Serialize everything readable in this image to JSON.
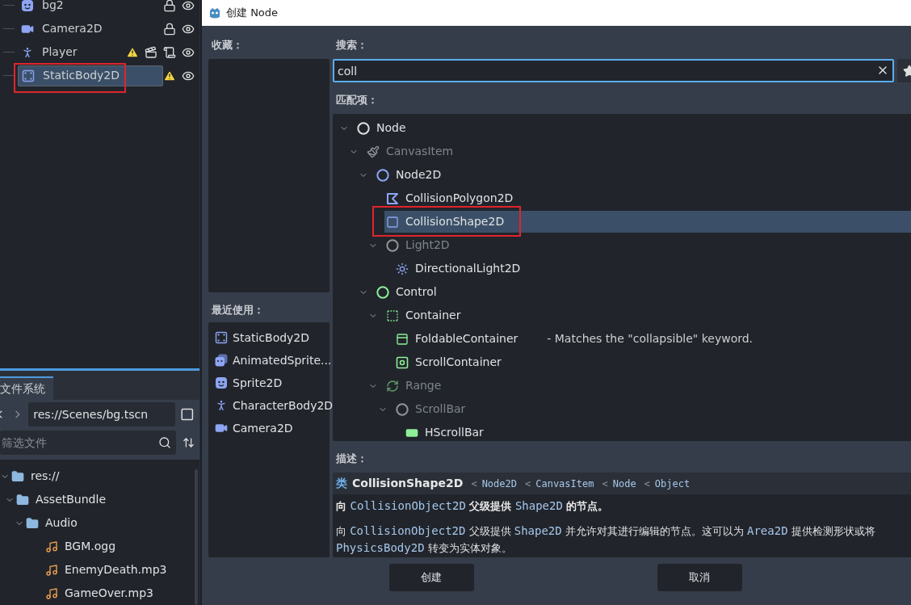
{
  "scene_tree": [
    {
      "name": "bg2",
      "kind": "sprite",
      "selected": false,
      "warning": false,
      "has_scene": false,
      "has_script": false,
      "locked": true,
      "visible": true
    },
    {
      "name": "Camera2D",
      "kind": "camera",
      "selected": false,
      "warning": false,
      "has_scene": false,
      "has_script": false,
      "locked": true,
      "visible": true
    },
    {
      "name": "Player",
      "kind": "character",
      "selected": false,
      "warning": true,
      "has_scene": true,
      "has_script": true,
      "locked": false,
      "visible": true
    },
    {
      "name": "StaticBody2D",
      "kind": "static",
      "selected": true,
      "warning": true,
      "has_scene": false,
      "has_script": false,
      "locked": false,
      "visible": true
    }
  ],
  "filesystem": {
    "tab": "文件系统",
    "path": "res://Scenes/bg.tscn",
    "filter_placeholder": "筛选文件",
    "tree": [
      {
        "name": "res://",
        "kind": "folder",
        "expanded": true,
        "children": [
          {
            "name": "AssetBundle",
            "kind": "folder",
            "expanded": true,
            "children": [
              {
                "name": "Audio",
                "kind": "folder",
                "expanded": true,
                "children": [
                  {
                    "name": "BGM.ogg",
                    "kind": "audio"
                  },
                  {
                    "name": "EnemyDeath.mp3",
                    "kind": "audio"
                  },
                  {
                    "name": "GameOver.mp3",
                    "kind": "audio"
                  }
                ]
              }
            ]
          }
        ]
      }
    ]
  },
  "dialog": {
    "title": "创建 Node",
    "favorites_label": "收藏：",
    "recent_label": "最近使用：",
    "recent": [
      {
        "name": "StaticBody2D",
        "kind": "static"
      },
      {
        "name": "AnimatedSprite...",
        "kind": "animated"
      },
      {
        "name": "Sprite2D",
        "kind": "sprite"
      },
      {
        "name": "CharacterBody2D",
        "kind": "character"
      },
      {
        "name": "Camera2D",
        "kind": "camera"
      }
    ],
    "search_label": "搜索：",
    "search_value": "coll",
    "matches_label": "匹配项：",
    "matches": [
      {
        "name": "Node",
        "kind": "circle-white",
        "dimmed": false,
        "selected": false,
        "children": [
          {
            "name": "CanvasItem",
            "kind": "brush",
            "dimmed": true,
            "selected": false,
            "children": [
              {
                "name": "Node2D",
                "kind": "circle-blue",
                "dimmed": false,
                "selected": false,
                "children": [
                  {
                    "name": "CollisionPolygon2D",
                    "kind": "polygon",
                    "dimmed": false,
                    "selected": false
                  },
                  {
                    "name": "CollisionShape2D",
                    "kind": "square",
                    "dimmed": false,
                    "selected": true
                  },
                  {
                    "name": "Light2D",
                    "kind": "circle-white",
                    "dimmed": true,
                    "selected": false,
                    "children": [
                      {
                        "name": "DirectionalLight2D",
                        "kind": "sun",
                        "dimmed": false,
                        "selected": false
                      }
                    ]
                  }
                ]
              },
              {
                "name": "Control",
                "kind": "circle-green",
                "dimmed": false,
                "selected": false,
                "children": [
                  {
                    "name": "Container",
                    "kind": "dotted",
                    "dimmed": false,
                    "selected": false,
                    "children": [
                      {
                        "name": "FoldableContainer",
                        "kind": "foldable",
                        "dimmed": false,
                        "selected": false,
                        "note": "- Matches the \"collapsible\" keyword."
                      },
                      {
                        "name": "ScrollContainer",
                        "kind": "scroll",
                        "dimmed": false,
                        "selected": false
                      }
                    ]
                  },
                  {
                    "name": "Range",
                    "kind": "range",
                    "dimmed": true,
                    "selected": false,
                    "children": [
                      {
                        "name": "ScrollBar",
                        "kind": "circle-white",
                        "dimmed": true,
                        "selected": false,
                        "children": [
                          {
                            "name": "HScrollBar",
                            "kind": "hscroll",
                            "dimmed": false,
                            "selected": false
                          }
                        ]
                      }
                    ]
                  }
                ]
              }
            ]
          }
        ]
      }
    ],
    "description_label": "描述：",
    "description": {
      "class_keyword": "类",
      "class_name": "CollisionShape2D",
      "separator": "<",
      "inherits": [
        "Node2D",
        "CanvasItem",
        "Node",
        "Object"
      ],
      "paragraphs": [
        [
          {
            "text": "向 ",
            "kind": "bold"
          },
          {
            "text": "CollisionObject2D",
            "kind": "ref"
          },
          {
            "text": " 父级提供 ",
            "kind": "bold"
          },
          {
            "text": "Shape2D",
            "kind": "ref"
          },
          {
            "text": " 的节点。",
            "kind": "bold"
          }
        ],
        [
          {
            "text": "向 ",
            "kind": "plain"
          },
          {
            "text": "CollisionObject2D",
            "kind": "ref"
          },
          {
            "text": " 父级提供 ",
            "kind": "plain"
          },
          {
            "text": "Shape2D",
            "kind": "ref"
          },
          {
            "text": " 并允许对其进行编辑的节点。这可以为 ",
            "kind": "plain"
          },
          {
            "text": "Area2D",
            "kind": "ref"
          },
          {
            "text": " 提供检测形状或将 ",
            "kind": "plain"
          },
          {
            "text": "PhysicsBody2D",
            "kind": "ref"
          },
          {
            "text": " 转变为实体对象。",
            "kind": "plain"
          }
        ]
      ]
    },
    "buttons": [
      "创建",
      "取消"
    ]
  }
}
